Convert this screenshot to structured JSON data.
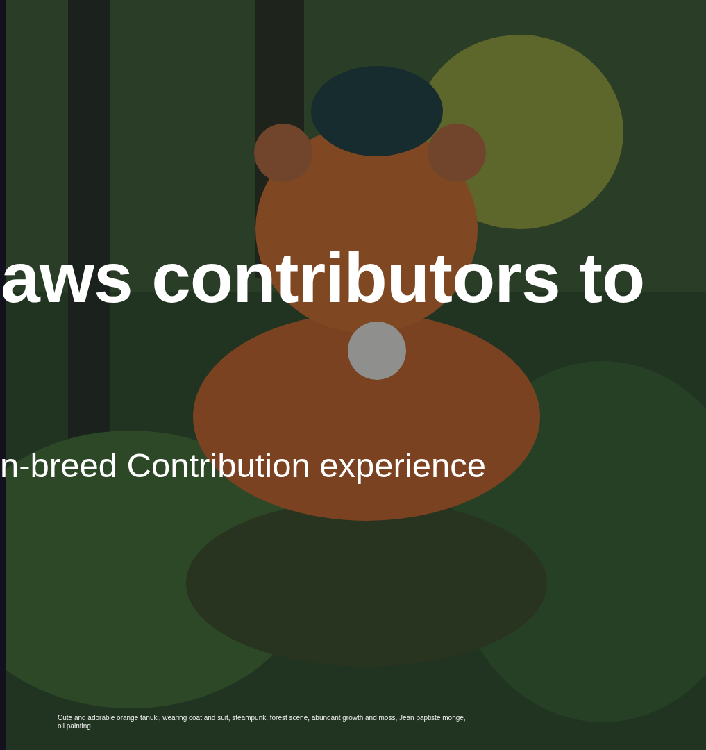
{
  "hero": {
    "headline": "aws contributors to",
    "subtitle": "n-breed Contribution experience",
    "caption": "Cute and adorable orange tanuki, wearing coat and suit, steampunk, forest scene, abundant growth and moss, Jean paptiste monge, oil painting"
  }
}
